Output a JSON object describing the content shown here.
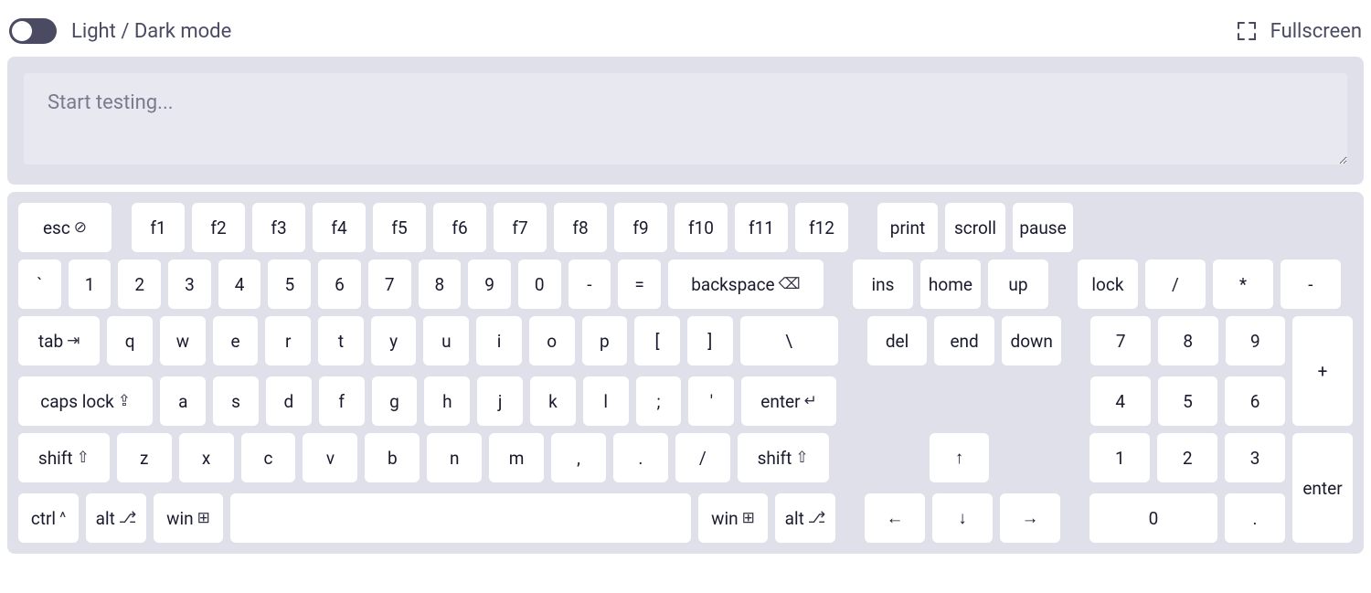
{
  "header": {
    "mode_label": "Light / Dark mode",
    "fullscreen_label": "Fullscreen"
  },
  "input": {
    "placeholder": "Start testing..."
  },
  "glyphs": {
    "esc": "⊘",
    "backspace": "⌫",
    "tab": "⇥",
    "caps": "⇪",
    "enter": "↵",
    "shift": "⇧",
    "ctrl": "^",
    "alt": "⎇",
    "win": "⊞",
    "up": "↑",
    "down": "↓",
    "left": "←",
    "right": "→"
  },
  "keys": {
    "esc": "esc",
    "f1": "f1",
    "f2": "f2",
    "f3": "f3",
    "f4": "f4",
    "f5": "f5",
    "f6": "f6",
    "f7": "f7",
    "f8": "f8",
    "f9": "f9",
    "f10": "f10",
    "f11": "f11",
    "f12": "f12",
    "print": "print",
    "scroll": "scroll",
    "pause": "pause",
    "backtick": "`",
    "n1": "1",
    "n2": "2",
    "n3": "3",
    "n4": "4",
    "n5": "5",
    "n6": "6",
    "n7": "7",
    "n8": "8",
    "n9": "9",
    "n0": "0",
    "minus": "-",
    "equals": "=",
    "backspace": "backspace",
    "ins": "ins",
    "home": "home",
    "pgup": "up",
    "numlock": "lock",
    "numdiv": "/",
    "nummul": "*",
    "numminus": "-",
    "tab": "tab",
    "q": "q",
    "w": "w",
    "e": "e",
    "r": "r",
    "t": "t",
    "y": "y",
    "u": "u",
    "i": "i",
    "o": "o",
    "p": "p",
    "lbracket": "[",
    "rbracket": "]",
    "backslash": "\\",
    "del": "del",
    "end": "end",
    "pgdn": "down",
    "num7": "7",
    "num8": "8",
    "num9": "9",
    "numplus": "+",
    "caps": "caps lock",
    "a": "a",
    "s": "s",
    "d": "d",
    "f": "f",
    "g": "g",
    "h": "h",
    "j": "j",
    "k": "k",
    "l": "l",
    "semicolon": ";",
    "quote": "'",
    "enter": "enter",
    "num4": "4",
    "num5": "5",
    "num6": "6",
    "shift_l": "shift",
    "z": "z",
    "x": "x",
    "c": "c",
    "v": "v",
    "b": "b",
    "n": "n",
    "m": "m",
    "comma": ",",
    "period": ".",
    "slash": "/",
    "shift_r": "shift",
    "arrow_up": "↑",
    "num1": "1",
    "num2": "2",
    "num3": "3",
    "numenter": "enter",
    "ctrl_l": "ctrl",
    "alt_l": "alt",
    "win_l": "win",
    "win_r": "win",
    "alt_r": "alt",
    "arrow_left": "←",
    "arrow_down": "↓",
    "arrow_right": "→",
    "num0": "0",
    "numdot": "."
  }
}
